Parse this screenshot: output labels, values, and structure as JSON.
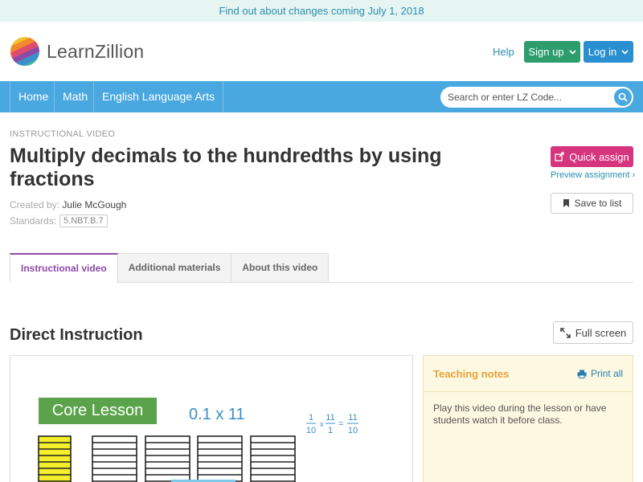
{
  "banner": {
    "text": "Find out about changes coming July 1, 2018"
  },
  "header": {
    "logo_text": "LearnZillion",
    "help": "Help",
    "signup": "Sign up",
    "login": "Log in"
  },
  "nav": {
    "items": [
      "Home",
      "Math",
      "English Language Arts"
    ],
    "search_placeholder": "Search or enter LZ Code..."
  },
  "lesson": {
    "type_label": "INSTRUCTIONAL VIDEO",
    "title": "Multiply decimals to the hundredths by using fractions",
    "created_by_label": "Created by:",
    "created_by": "Julie McGough",
    "standards_label": "Standards:",
    "standard": "5.NBT.B.7"
  },
  "actions": {
    "quick_assign": "Quick assign",
    "preview": "Preview assignment ›",
    "save": "Save to list"
  },
  "tabs": [
    "Instructional video",
    "Additional materials",
    "About this video"
  ],
  "section": {
    "title": "Direct Instruction",
    "full_screen": "Full screen"
  },
  "video": {
    "core_lesson": "Core Lesson",
    "expression": "0.1 x 11",
    "fraction_a_num": "1",
    "fraction_a_den": "10",
    "fraction_b_num": "11",
    "fraction_b_den": "1",
    "fraction_c_num": "11",
    "fraction_c_den": "10"
  },
  "notes": {
    "title": "Teaching notes",
    "print_all": "Print all",
    "body": "Play this video during the lesson or have students watch it before class."
  },
  "colors": {
    "nav": "#4aa8e0",
    "signup": "#2e9d6e",
    "login": "#2a8fd0",
    "quick_assign": "#d6347e",
    "active_tab": "#8e4aa8",
    "notes_title": "#e8a33a"
  }
}
